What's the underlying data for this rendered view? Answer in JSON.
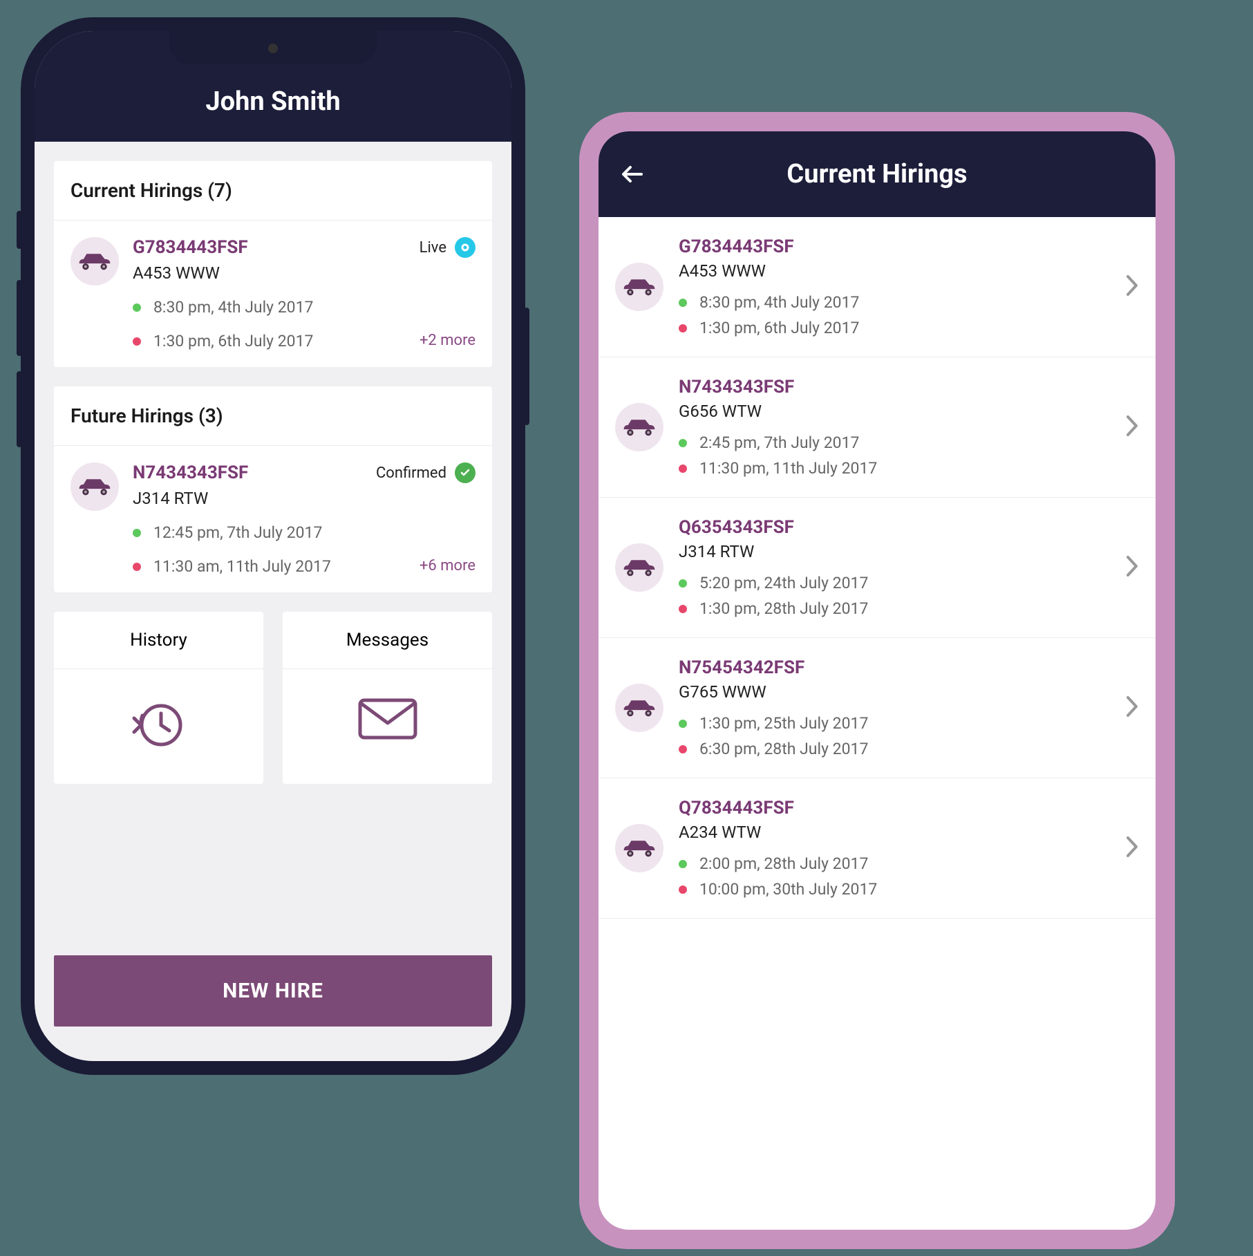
{
  "colors": {
    "bg": "#4d6e73",
    "header": "#1d1e3a",
    "accent": "#7c4a76",
    "ref": "#7a3a74",
    "live": "#26c8e8",
    "confirmed": "#4caf50",
    "dot_green": "#5cc95c",
    "dot_red": "#e8476b"
  },
  "phone1": {
    "header_title": "John Smith",
    "current": {
      "title": "Current Hirings (7)",
      "item": {
        "ref": "G7834443FSF",
        "plate": "A453 WWW",
        "start": "8:30 pm, 4th July 2017",
        "end": "1:30 pm, 6th July 2017",
        "status_label": "Live",
        "more": "+2 more"
      }
    },
    "future": {
      "title": "Future Hirings (3)",
      "item": {
        "ref": "N7434343FSF",
        "plate": "J314 RTW",
        "start": "12:45 pm, 7th July 2017",
        "end": "11:30 am, 11th July 2017",
        "status_label": "Confirmed",
        "more": "+6 more"
      }
    },
    "actions": {
      "history": "History",
      "messages": "Messages"
    },
    "new_hire": "NEW HIRE"
  },
  "phone2": {
    "header_title": "Current Hirings",
    "items": [
      {
        "ref": "G7834443FSF",
        "plate": "A453 WWW",
        "start": "8:30 pm, 4th July 2017",
        "end": "1:30 pm, 6th July 2017"
      },
      {
        "ref": "N7434343FSF",
        "plate": "G656 WTW",
        "start": "2:45 pm, 7th July 2017",
        "end": "11:30 pm, 11th July 2017"
      },
      {
        "ref": "Q6354343FSF",
        "plate": "J314 RTW",
        "start": "5:20 pm, 24th July 2017",
        "end": "1:30 pm, 28th July 2017"
      },
      {
        "ref": "N75454342FSF",
        "plate": "G765 WWW",
        "start": "1:30 pm, 25th July 2017",
        "end": "6:30 pm, 28th July 2017"
      },
      {
        "ref": "Q7834443FSF",
        "plate": "A234 WTW",
        "start": "2:00 pm, 28th July 2017",
        "end": "10:00 pm, 30th July 2017"
      }
    ]
  }
}
